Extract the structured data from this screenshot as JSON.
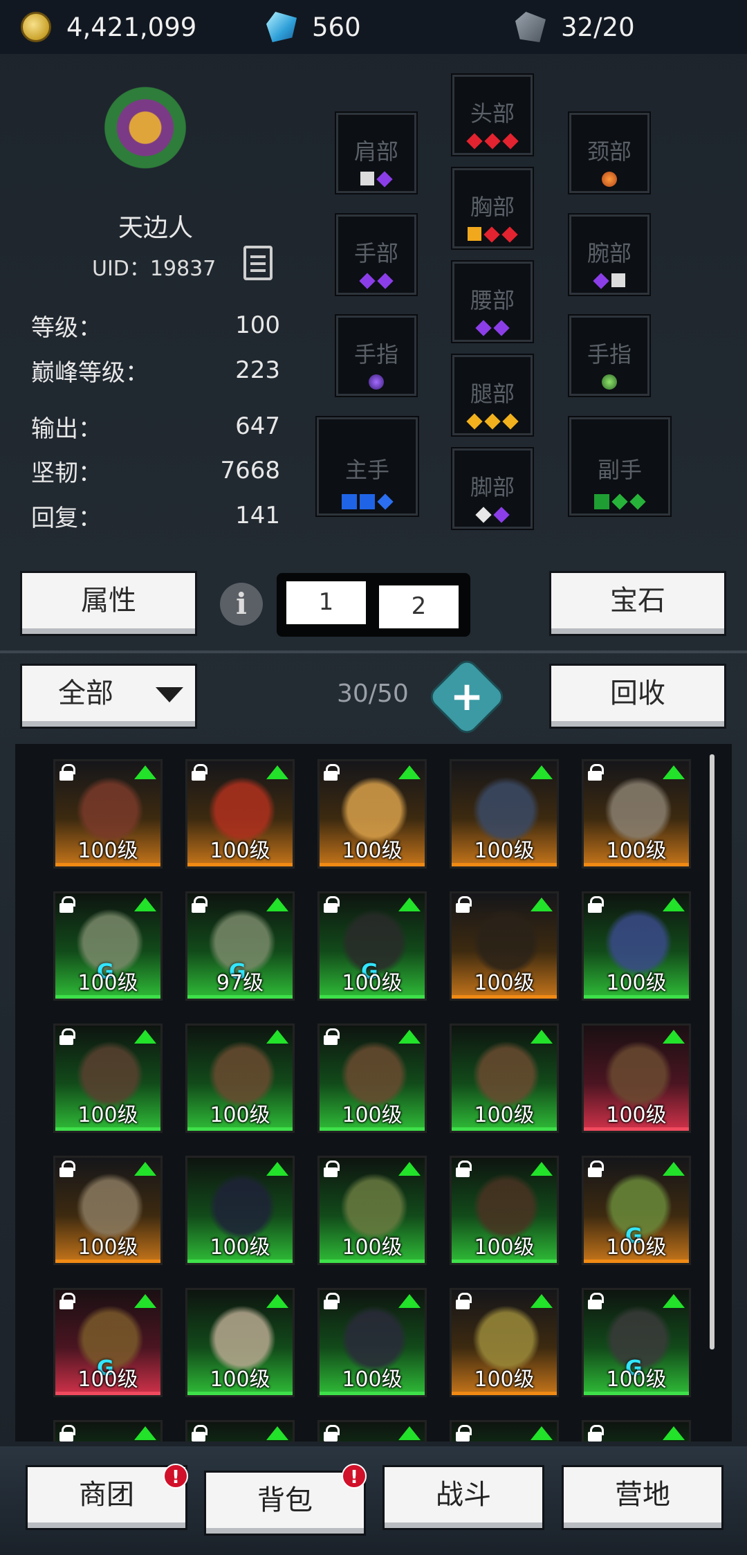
{
  "resources": {
    "gold": "4,421,099",
    "gems": "560",
    "stones": "32/20"
  },
  "character": {
    "name": "天边人",
    "uid": "UID：19837",
    "stats": [
      {
        "label": "等级：",
        "value": "100"
      },
      {
        "label": "巅峰等级：",
        "value": "223"
      },
      {
        "label": "输出：",
        "value": "647"
      },
      {
        "label": "坚韧：",
        "value": "7668"
      },
      {
        "label": "回复：",
        "value": "141"
      }
    ]
  },
  "equipment": {
    "head": {
      "label": "头部",
      "gems": [
        "red",
        "red",
        "red"
      ]
    },
    "shoulder": {
      "label": "肩部",
      "gems": [
        "sq-white",
        "purple"
      ]
    },
    "neck": {
      "label": "颈部",
      "gems": [
        "orb-orange"
      ]
    },
    "chest": {
      "label": "胸部",
      "gems": [
        "sq-orange",
        "red",
        "red"
      ]
    },
    "hand": {
      "label": "手部",
      "gems": [
        "purple",
        "purple"
      ]
    },
    "wrist": {
      "label": "腕部",
      "gems": [
        "purple",
        "sq-white"
      ]
    },
    "waist": {
      "label": "腰部",
      "gems": [
        "purple",
        "purple"
      ]
    },
    "finger_left": {
      "label": "手指",
      "gems": [
        "orb-purple"
      ]
    },
    "finger_right": {
      "label": "手指",
      "gems": [
        "orb-green"
      ]
    },
    "legs": {
      "label": "腿部",
      "gems": [
        "orange",
        "orange",
        "orange"
      ]
    },
    "main_hand": {
      "label": "主手",
      "gems": [
        "sq-blue",
        "sq-blue",
        "blue"
      ]
    },
    "off_hand": {
      "label": "副手",
      "gems": [
        "sq-green",
        "green",
        "green"
      ]
    },
    "feet": {
      "label": "脚部",
      "gems": [
        "white",
        "purple"
      ]
    }
  },
  "buttons": {
    "attributes": "属性",
    "info": "i",
    "page1": "1",
    "page2": "2",
    "gem": "宝石",
    "filter": "全部",
    "recycle": "回收",
    "add": "+"
  },
  "inventory": {
    "capacity": "30/50",
    "items": [
      {
        "level": "100级",
        "rarity": "orange",
        "locked": true,
        "rune": false,
        "color": "#7a3a2a"
      },
      {
        "level": "100级",
        "rarity": "orange",
        "locked": true,
        "rune": false,
        "color": "#b0301e"
      },
      {
        "level": "100级",
        "rarity": "orange",
        "locked": true,
        "rune": false,
        "color": "#d8a04a"
      },
      {
        "level": "100级",
        "rarity": "orange",
        "locked": false,
        "rune": false,
        "color": "#3a4a66"
      },
      {
        "level": "100级",
        "rarity": "orange",
        "locked": true,
        "rune": false,
        "color": "#8a8070"
      },
      {
        "level": "100级",
        "rarity": "green",
        "locked": true,
        "rune": true,
        "color": "#7a8a6a"
      },
      {
        "level": "97级",
        "rarity": "green",
        "locked": true,
        "rune": true,
        "color": "#7a8a6a"
      },
      {
        "level": "100级",
        "rarity": "green",
        "locked": true,
        "rune": true,
        "color": "#2a2a2a"
      },
      {
        "level": "100级",
        "rarity": "orange",
        "locked": true,
        "rune": false,
        "color": "#2a2218"
      },
      {
        "level": "100级",
        "rarity": "green",
        "locked": true,
        "rune": false,
        "color": "#3a4a8a"
      },
      {
        "level": "100级",
        "rarity": "green",
        "locked": true,
        "rune": false,
        "color": "#5a4030"
      },
      {
        "level": "100级",
        "rarity": "green",
        "locked": false,
        "rune": false,
        "color": "#6a4a30"
      },
      {
        "level": "100级",
        "rarity": "green",
        "locked": true,
        "rune": false,
        "color": "#6a4a30"
      },
      {
        "level": "100级",
        "rarity": "green",
        "locked": false,
        "rune": false,
        "color": "#6a4a30"
      },
      {
        "level": "100级",
        "rarity": "red",
        "locked": false,
        "rune": false,
        "color": "#6a4a30"
      },
      {
        "level": "100级",
        "rarity": "orange",
        "locked": true,
        "rune": false,
        "color": "#8a7a60"
      },
      {
        "level": "100级",
        "rarity": "green",
        "locked": false,
        "rune": false,
        "color": "#1e2238"
      },
      {
        "level": "100级",
        "rarity": "green",
        "locked": true,
        "rune": false,
        "color": "#6a7a40"
      },
      {
        "level": "100级",
        "rarity": "green",
        "locked": true,
        "rune": false,
        "color": "#4a3222"
      },
      {
        "level": "100级",
        "rarity": "orange",
        "locked": true,
        "rune": true,
        "color": "#6a8a3a"
      },
      {
        "level": "100级",
        "rarity": "red",
        "locked": true,
        "rune": true,
        "color": "#7a5a2a"
      },
      {
        "level": "100级",
        "rarity": "green",
        "locked": false,
        "rune": false,
        "color": "#b8a890"
      },
      {
        "level": "100级",
        "rarity": "green",
        "locked": true,
        "rune": false,
        "color": "#2a2a3a"
      },
      {
        "level": "100级",
        "rarity": "orange",
        "locked": true,
        "rune": false,
        "color": "#9a8a3a"
      },
      {
        "level": "100级",
        "rarity": "green",
        "locked": true,
        "rune": true,
        "color": "#3a3a3a"
      }
    ]
  },
  "nav": {
    "guild": "商团",
    "backpack": "背包",
    "battle": "战斗",
    "camp": "营地",
    "badge": "!"
  }
}
